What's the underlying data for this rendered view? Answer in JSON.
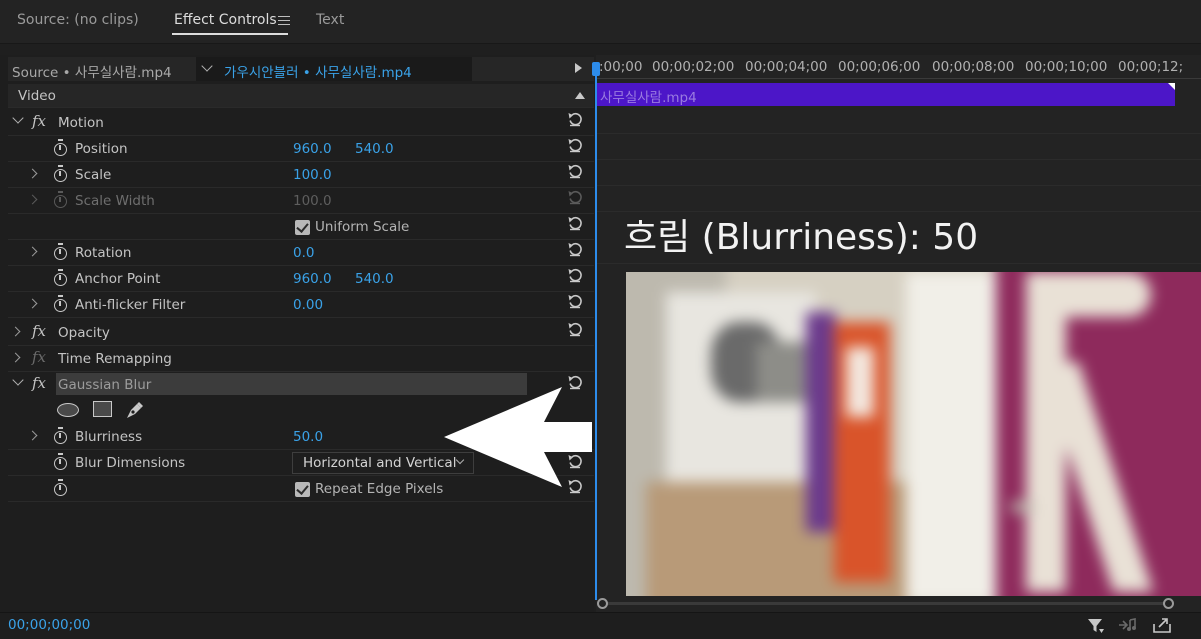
{
  "tabs": [
    {
      "label": "Source: (no clips)"
    },
    {
      "label": "Effect Controls"
    },
    {
      "label": "Text"
    }
  ],
  "source_row": {
    "source_label": "Source • 사무실사람.mp4",
    "clip_label": "가우시안블러 • 사무실사람.mp4"
  },
  "section": {
    "label": "Video"
  },
  "rows": {
    "motion": "Motion",
    "position": {
      "label": "Position",
      "x": "960.0",
      "y": "540.0"
    },
    "scale": {
      "label": "Scale",
      "value": "100.0"
    },
    "scale_width": {
      "label": "Scale Width",
      "value": "100.0"
    },
    "uniform_scale": {
      "label": "Uniform Scale",
      "checked": true
    },
    "rotation": {
      "label": "Rotation",
      "value": "0.0"
    },
    "anchor_point": {
      "label": "Anchor Point",
      "x": "960.0",
      "y": "540.0"
    },
    "anti_flicker": {
      "label": "Anti-flicker Filter",
      "value": "0.00"
    },
    "opacity": "Opacity",
    "time_remapping": "Time Remapping",
    "gaussian_blur": "Gaussian Blur",
    "blurriness": {
      "label": "Blurriness",
      "value": "50.0"
    },
    "blur_dimensions": {
      "label": "Blur Dimensions",
      "value": "Horizontal and Vertical"
    },
    "repeat_edge": {
      "label": "Repeat Edge Pixels",
      "checked": true
    },
    "fx_symbol": "fx"
  },
  "timeline": {
    "ticks": [
      ":00;00",
      "00;00;02;00",
      "00;00;04;00",
      "00;00;06;00",
      "00;00;08;00",
      "00;00;10;00",
      "00;00;12;"
    ],
    "clip_label": "사무실사람.mp4",
    "clip_color": "#4c16c8"
  },
  "annotation": {
    "text": "흐림 (Blurriness): 50"
  },
  "footer": {
    "timecode": "00;00;00;00"
  },
  "colors": {
    "accent": "#3aa2e8",
    "playhead": "#2d8ceb"
  }
}
